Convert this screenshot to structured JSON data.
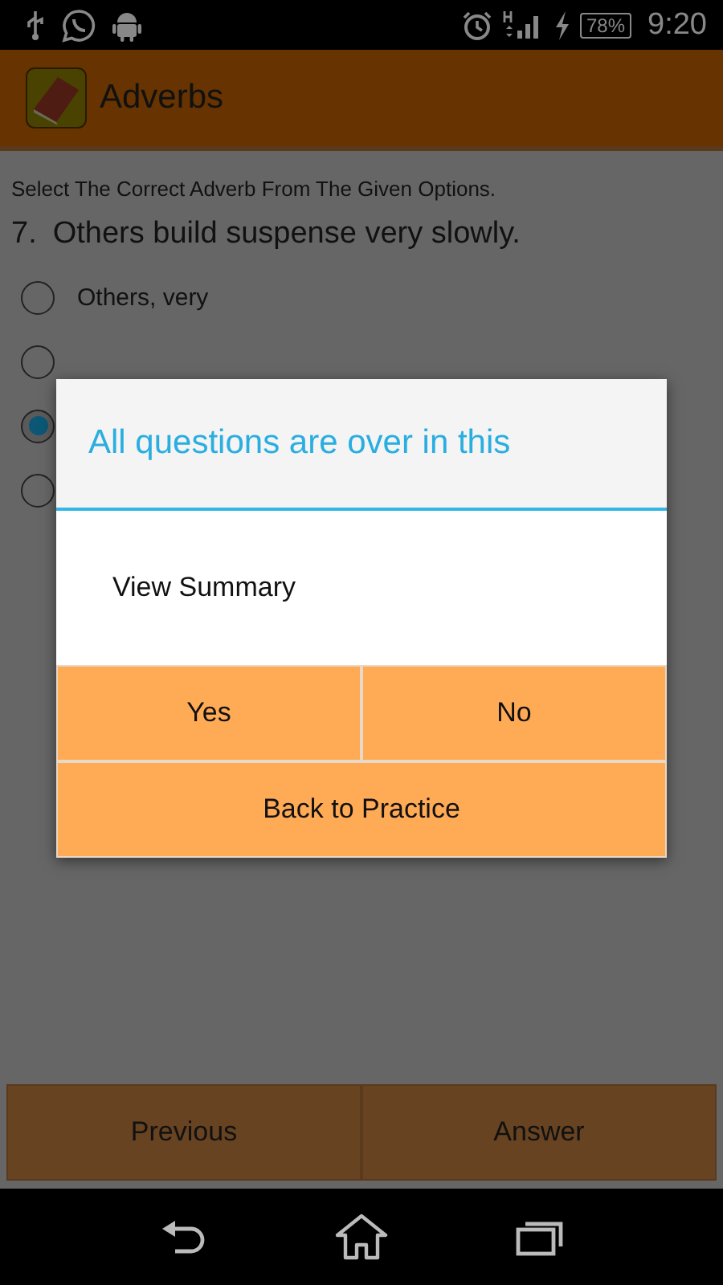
{
  "status_bar": {
    "battery": "78%",
    "time": "9:20"
  },
  "app_bar": {
    "title": "Adverbs"
  },
  "instruction": "Select The Correct Adverb From The Given Options.",
  "question": {
    "number": "7.",
    "text": "Others build suspense very slowly."
  },
  "options": [
    {
      "label": "Others, very",
      "selected": false
    },
    {
      "selected": false
    },
    {
      "selected": true
    },
    {
      "selected": false
    }
  ],
  "bottom_buttons": [
    "Previous",
    "Answer"
  ],
  "dialog": {
    "title": "All questions are over in this",
    "message": "View Summary",
    "buttons": [
      "Yes",
      "No"
    ],
    "wide_button": "Back to Practice"
  }
}
